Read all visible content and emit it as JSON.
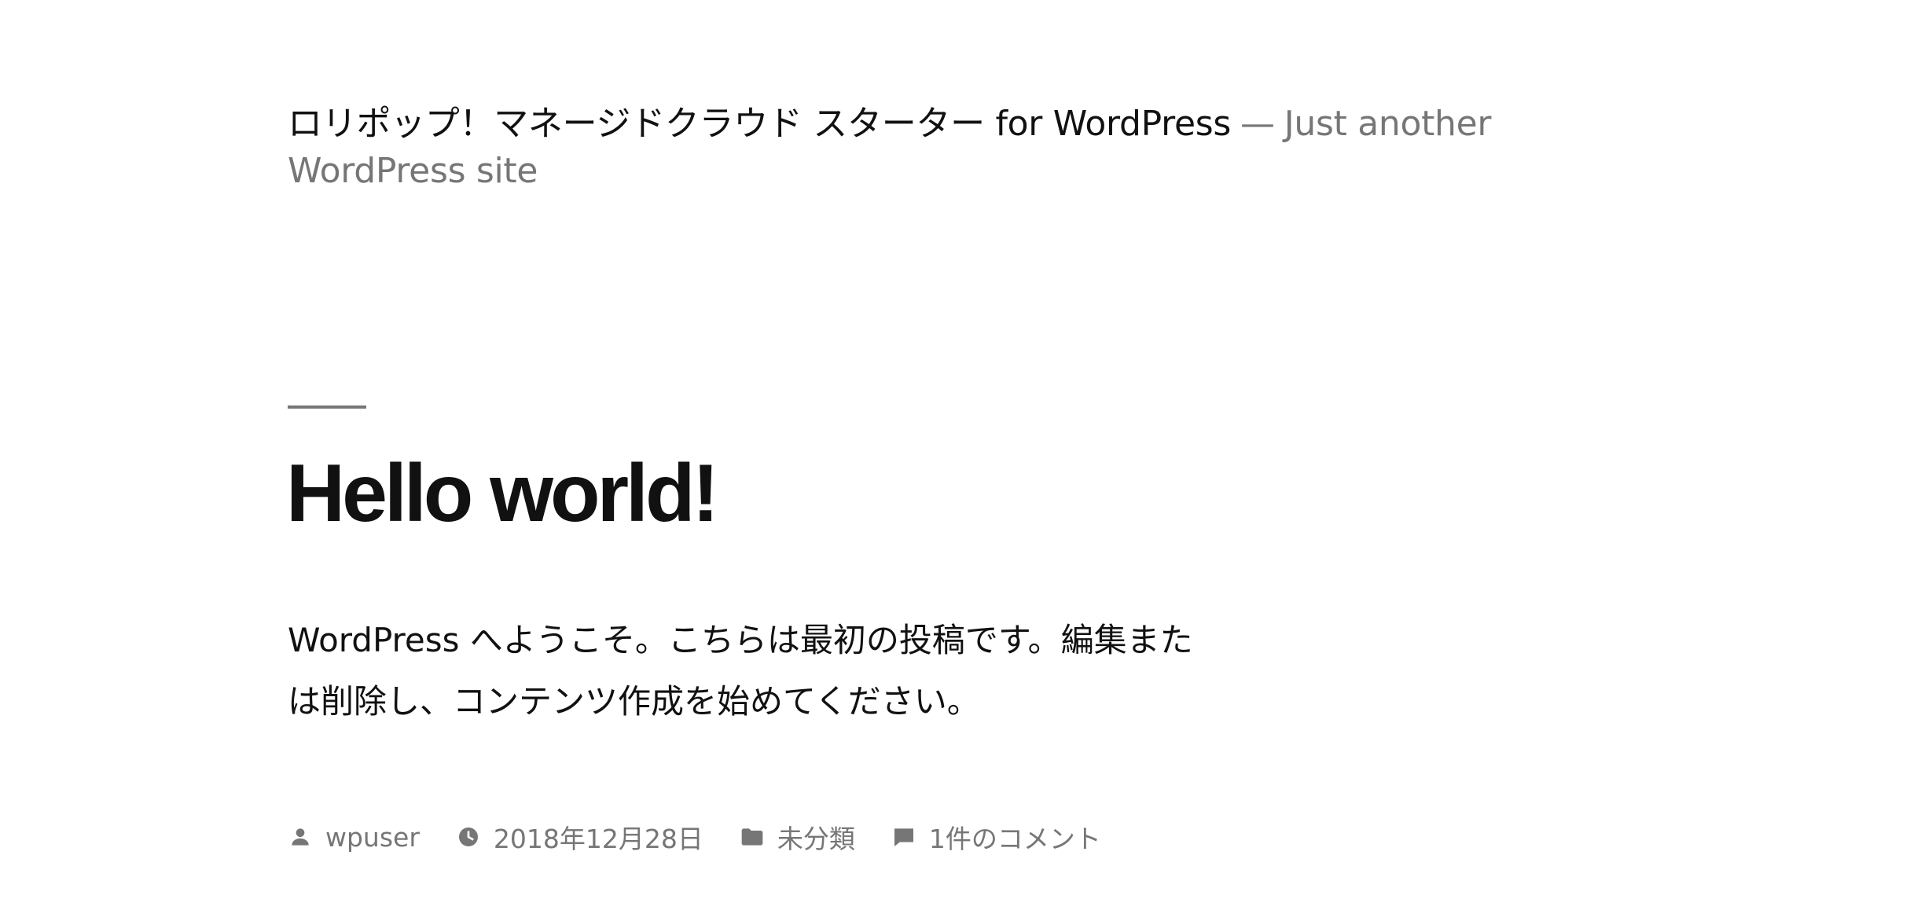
{
  "header": {
    "site_title": "ロリポップ！マネージドクラウド スターター for WordPress",
    "separator": "—",
    "tagline": "Just another WordPress site"
  },
  "post": {
    "title": "Hello world!",
    "content": "WordPress へようこそ。こちらは最初の投稿です。編集または削除し、コンテンツ作成を始めてください。",
    "meta": {
      "author": "wpuser",
      "date": "2018年12月28日",
      "category": "未分類",
      "comments": "1件のコメント"
    }
  },
  "icons": {
    "author": "person-icon",
    "date": "clock-icon",
    "category": "folder-icon",
    "comments": "comment-icon"
  },
  "colors": {
    "text": "#111111",
    "secondary": "#767676",
    "background": "#ffffff"
  }
}
